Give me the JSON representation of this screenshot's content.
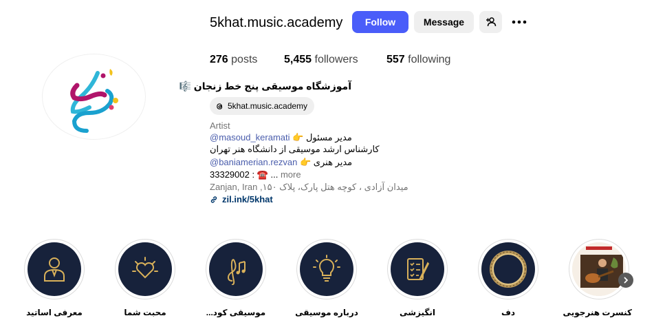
{
  "profile": {
    "username": "5khat.music.academy",
    "follow_label": "Follow",
    "message_label": "Message",
    "add_user_icon": "add-user-icon",
    "more_icon": "more-options-icon"
  },
  "stats": {
    "posts_count": "276",
    "posts_label": "posts",
    "followers_count": "5,455",
    "followers_label": "followers",
    "following_count": "557",
    "following_label": "following"
  },
  "bio": {
    "name": "آموزشگاه موسیقی پنج خط زنجان",
    "threads_handle": "5khat.music.academy",
    "category": "Artist",
    "line1_text": "مدیر مسئول 👉",
    "line1_mention": "@masoud_keramati",
    "line2_text": "کارشناس ارشد موسیقی از دانشگاه هنر تهران",
    "line3_text": "مدیر هنری 👉",
    "line3_mention": "@baniamerian.rezvan",
    "line4_text": "33329002 : ☎️ ...",
    "line4_more": "more",
    "address": "Zanjan, Iran ,میدان آزادی ، کوچه هتل پارک، پلاک ۱۵۰",
    "link": "zil.ink/5khat"
  },
  "highlights": [
    {
      "label": "معرفی اساتید",
      "icon": "teacher-icon"
    },
    {
      "label": "محبت شما",
      "icon": "heart-icon"
    },
    {
      "label": "موسیقی کود...",
      "icon": "music-notes-icon"
    },
    {
      "label": "درباره موسیقی",
      "icon": "lightbulb-icon"
    },
    {
      "label": "انگیزشی",
      "icon": "checklist-icon"
    },
    {
      "label": "دف",
      "icon": "daf-drum-icon"
    },
    {
      "label": "کنسرت هنرجویی",
      "icon": "concert-photo"
    }
  ],
  "colors": {
    "follow_button": "#4a5df9",
    "highlight_bg": "#17223b",
    "highlight_icon": "#d9b15a",
    "mention": "#4a5dac",
    "link": "#00376b"
  }
}
